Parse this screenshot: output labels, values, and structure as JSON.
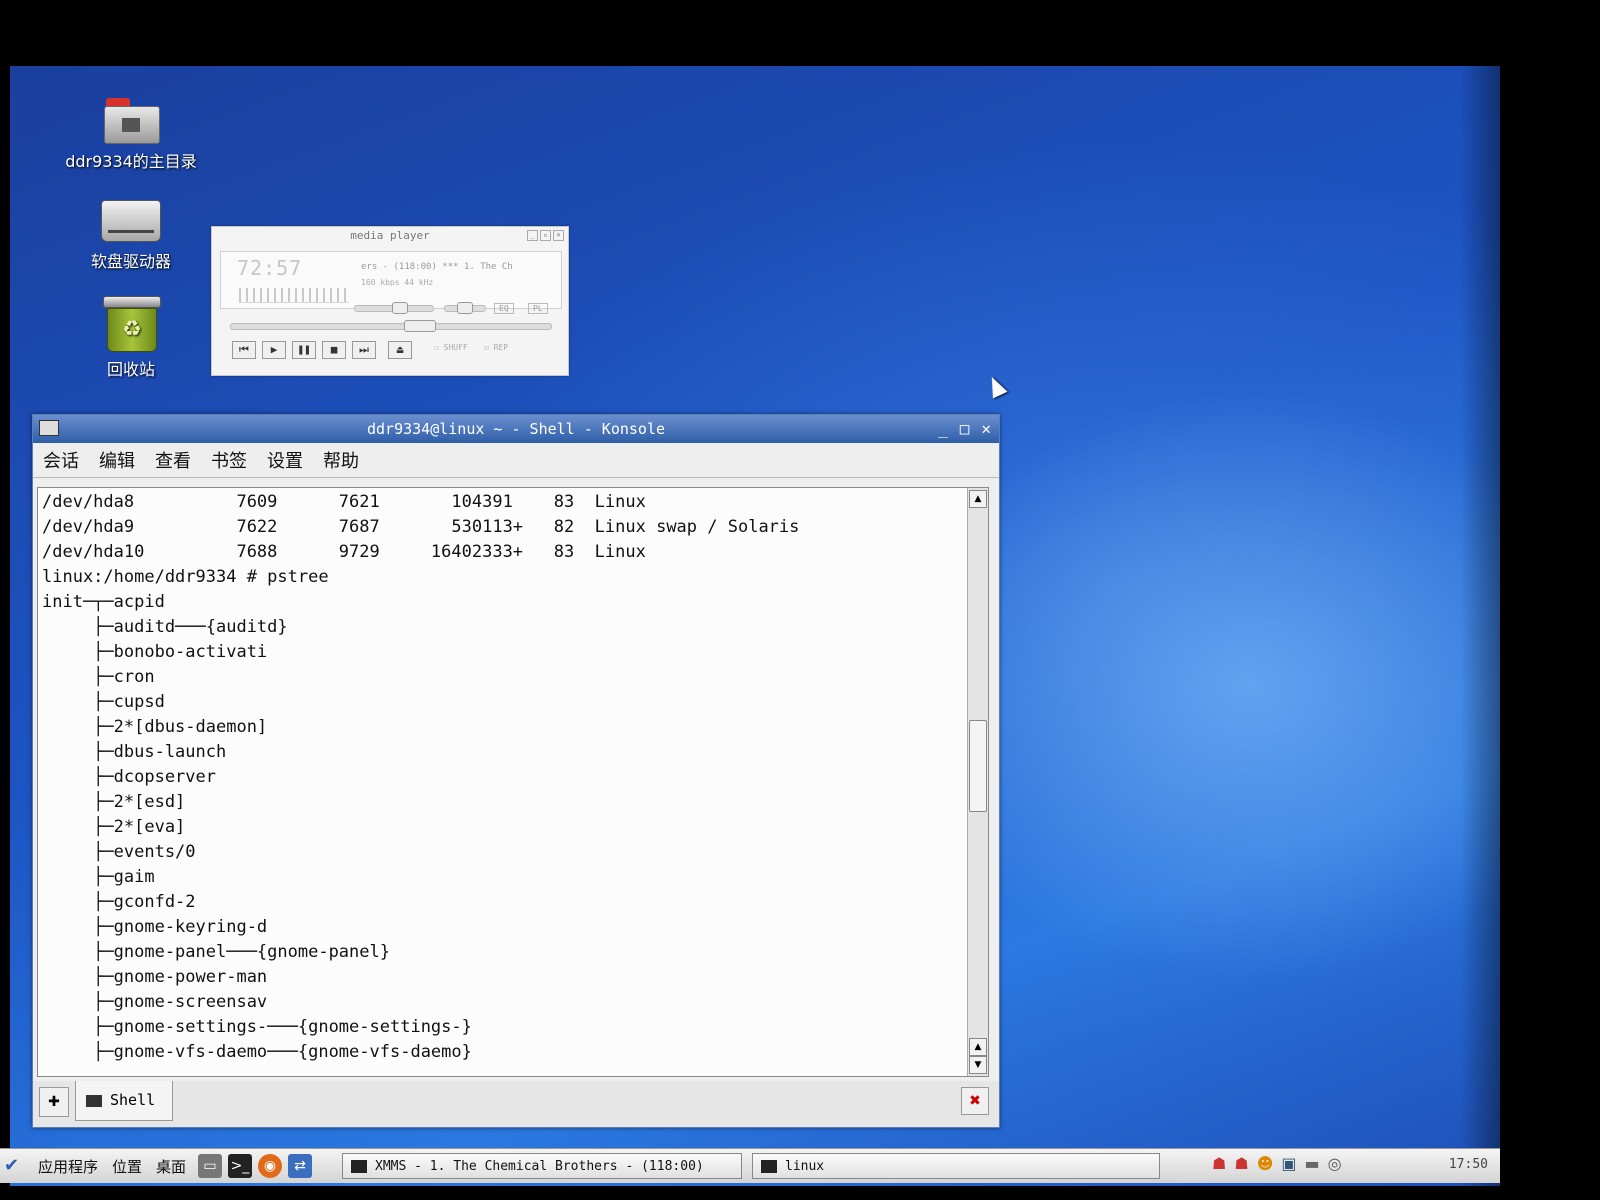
{
  "desktop": {
    "icons": [
      {
        "label": "ddr9334的主目录",
        "icon": "home-folder-icon"
      },
      {
        "label": "软盘驱动器",
        "icon": "floppy-drive-icon"
      },
      {
        "label": "回收站",
        "icon": "trash-icon"
      }
    ]
  },
  "media_player": {
    "title": "media player",
    "time": "72:57",
    "song": "ers - (118:00)  ***  1. The Ch",
    "bitrate": "160 kbps  44 kHz",
    "eq_label": "EQ",
    "pl_label": "PL",
    "shuffle_label": "SHUFF",
    "repeat_label": "REP",
    "controls": [
      "prev-icon",
      "play-icon",
      "pause-icon",
      "stop-icon",
      "next-icon",
      "eject-icon"
    ],
    "volume": 0.6,
    "balance": 0.5,
    "position": 0.6
  },
  "konsole": {
    "title": "ddr9334@linux ~ - Shell - Konsole",
    "menu": [
      "会话",
      "编辑",
      "查看",
      "书签",
      "设置",
      "帮助"
    ],
    "lines": [
      "/dev/hda8          7609      7621       104391    83  Linux",
      "/dev/hda9          7622      7687       530113+   82  Linux swap / Solaris",
      "/dev/hda10         7688      9729     16402333+   83  Linux",
      "linux:/home/ddr9334 # pstree",
      "init─┬─acpid",
      "     ├─auditd───{auditd}",
      "     ├─bonobo-activati",
      "     ├─cron",
      "     ├─cupsd",
      "     ├─2*[dbus-daemon]",
      "     ├─dbus-launch",
      "     ├─dcopserver",
      "     ├─2*[esd]",
      "     ├─2*[eva]",
      "     ├─events/0",
      "     ├─gaim",
      "     ├─gconfd-2",
      "     ├─gnome-keyring-d",
      "     ├─gnome-panel───{gnome-panel}",
      "     ├─gnome-power-man",
      "     ├─gnome-screensav",
      "     ├─gnome-settings-───{gnome-settings-}",
      "     ├─gnome-vfs-daemo───{gnome-vfs-daemo}"
    ],
    "tab_label": "Shell"
  },
  "taskbar": {
    "menus": [
      "应用程序",
      "位置",
      "桌面"
    ],
    "tasks": [
      {
        "label": "XMMS - 1. The Chemical Brothers -  (118:00)"
      },
      {
        "label": "linux"
      }
    ],
    "clock": "17:50"
  },
  "colors": {
    "desktop_blue": "#1d55c4",
    "title_bar": "#2f5ea8"
  }
}
